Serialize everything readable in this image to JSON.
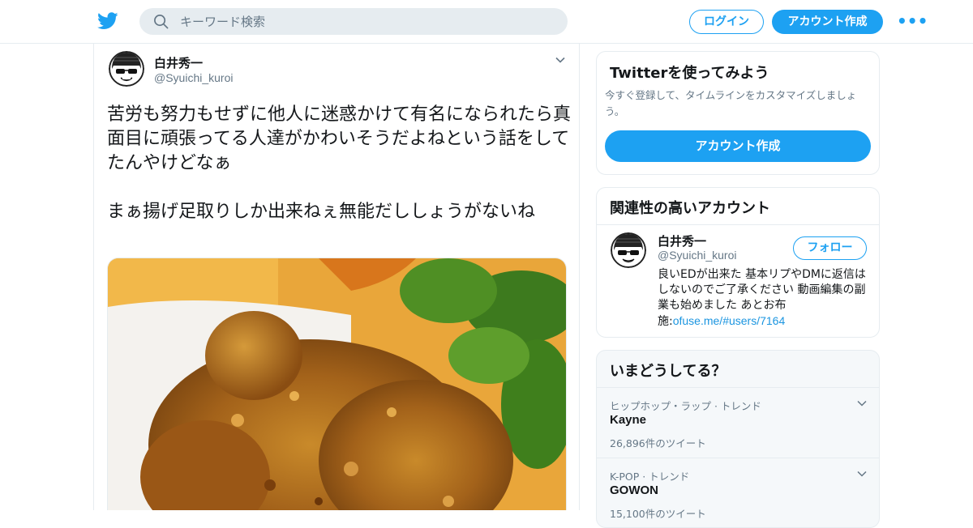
{
  "header": {
    "search_placeholder": "キーワード検索",
    "login_label": "ログイン",
    "signup_label": "アカウント作成",
    "more_label": "•••",
    "accent_color": "#1da1f2"
  },
  "tweet": {
    "author_name": "白井秀一",
    "author_handle": "@Syuichi_kuroi",
    "text_paragraph_1": "苦労も努力もせずに他人に迷惑かけて有名になられたら真面目に頑張ってる人達がかわいそうだよねという話をしてたんやけどなぁ",
    "text_paragraph_2": "まぁ揚げ足取りしか出来ねぇ無能だししょうがないね",
    "media_icon": "fried-chicken-photo"
  },
  "signup_card": {
    "title": "Twitterを使ってみよう",
    "description": "今すぐ登録して、タイムラインをカスタマイズしましょう。",
    "button_label": "アカウント作成"
  },
  "related_card": {
    "title": "関連性の高いアカウント",
    "account_name": "白井秀一",
    "account_handle": "@Syuichi_kuroi",
    "follow_label": "フォロー",
    "bio_text": "良いEDが出来た 基本リプやDMに返信はしないのでご了承ください 動画編集の副業も始めました あとお布施:",
    "bio_link": "ofuse.me/#users/7164"
  },
  "trends_card": {
    "title": "いまどうしてる？",
    "items": [
      {
        "meta": "ヒップホップ・ラップ · トレンド",
        "name": "Kayne",
        "count": "26,896件のツイート"
      },
      {
        "meta": "K-POP · トレンド",
        "name": "GOWON",
        "count": "15,100件のツイート"
      }
    ]
  }
}
